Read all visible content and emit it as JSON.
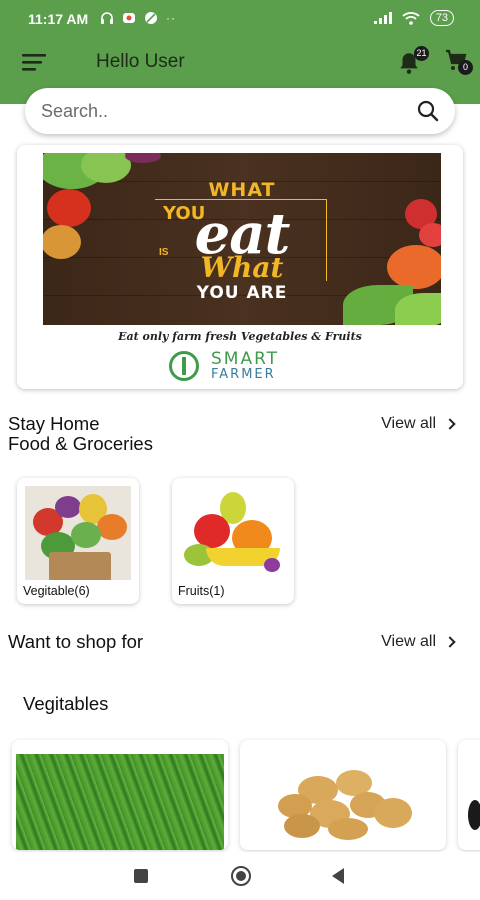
{
  "status_bar": {
    "time": "11:17 AM",
    "battery": "73"
  },
  "header": {
    "title": "Hello User",
    "notification_count": "21",
    "cart_count": "0"
  },
  "search": {
    "placeholder": "Search.."
  },
  "banner": {
    "line1": "WHAT",
    "line2": "YOU",
    "line3": "eat",
    "line3_small": "IS",
    "line3b": "What",
    "line4": "YOU ARE",
    "tagline": "Eat only farm fresh Vegetables & Fruits",
    "brand_top": "SMART",
    "brand_bottom": "FARMER"
  },
  "section_groceries": {
    "title_line1": "Stay Home",
    "title_line2": "Food & Groceries",
    "view_all": "View all",
    "categories": [
      {
        "label": "Vegitable(6)"
      },
      {
        "label": "Fruits(1)"
      }
    ]
  },
  "section_shop": {
    "title": "Want to shop for",
    "view_all": "View all",
    "subheading": "Vegitables"
  }
}
